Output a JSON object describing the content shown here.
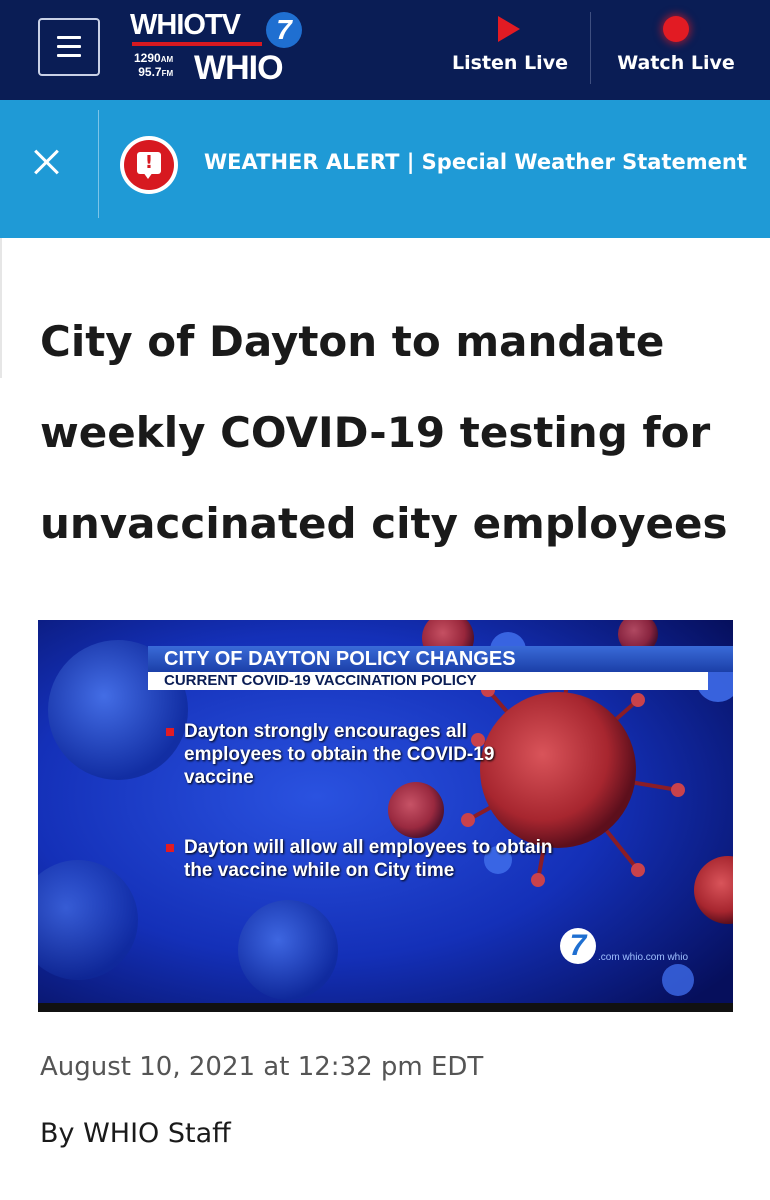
{
  "header": {
    "menu_icon": "hamburger-menu-icon",
    "logo": {
      "brand": "WHIOTV",
      "channel": "7",
      "am_frequency": "1290",
      "am_unit": "AM",
      "fm_frequency": "95.7",
      "fm_unit": "FM",
      "radio_brand": "WHIO"
    },
    "listen_live": {
      "label": "Listen Live",
      "icon": "play-icon",
      "color": "#e21b23"
    },
    "watch_live": {
      "label": "Watch Live",
      "icon": "live-record-icon",
      "color": "#e21b23"
    },
    "background": "#0a1d55"
  },
  "weather_alert": {
    "close_icon": "close-icon",
    "alert_icon": "alert-icon",
    "text": "WEATHER ALERT | Special Weather Statement",
    "background": "#1f9ad6"
  },
  "article": {
    "headline": "City of Dayton to mandate weekly COVID-19 testing for unvaccinated city employees",
    "image": {
      "banner_title": "CITY OF DAYTON POLICY CHANGES",
      "banner_subtitle": "CURRENT COVID-19 VACCINATION POLICY",
      "bullets": [
        "Dayton strongly encourages all employees to obtain the COVID-19 vaccine",
        "Dayton will allow all employees to obtain the vaccine while on City time"
      ],
      "station_bug": "7",
      "bug_url": ".com  whio.com  whio"
    },
    "published": "August 10, 2021 at 12:32 pm EDT",
    "byline": "By WHIO Staff"
  }
}
